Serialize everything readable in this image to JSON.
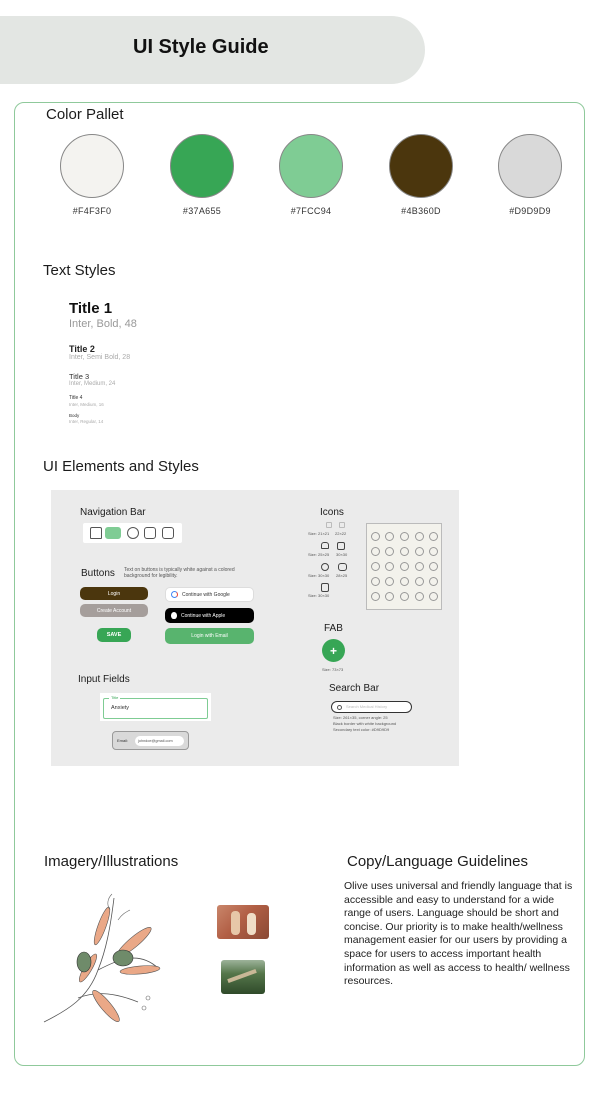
{
  "header": {
    "title": "UI Style Guide"
  },
  "color_pallet": {
    "title": "Color Pallet",
    "swatches": [
      {
        "hex": "#F4F3F0",
        "label": "#F4F3F0"
      },
      {
        "hex": "#37A655",
        "label": "#37A655"
      },
      {
        "hex": "#7FCC94",
        "label": "#7FCC94"
      },
      {
        "hex": "#4B360D",
        "label": "#4B360D"
      },
      {
        "hex": "#D9D9D9",
        "label": "#D9D9D9"
      }
    ]
  },
  "text_styles": {
    "title": "Text Styles",
    "items": [
      {
        "name": "Title 1",
        "spec": "Inter, Bold, 48"
      },
      {
        "name": "Title 2",
        "spec": "Inter, Semi Bold, 28"
      },
      {
        "name": "Title 3",
        "spec": "Inter, Medium, 24"
      },
      {
        "name": "Title 4",
        "spec": "Inter, Medium, 16"
      },
      {
        "name": "Body",
        "spec": "Inter, Regular, 14"
      }
    ]
  },
  "ui_elements": {
    "title": "UI Elements and Styles",
    "navigation_bar": "Navigation Bar",
    "buttons": {
      "title": "Buttons",
      "note": "Text on buttons is typically white against a colored background for legibility.",
      "login": "Login",
      "create_account": "Create Account",
      "save": "SAVE",
      "google": "Continue with Google",
      "apple": "Continue with Apple",
      "email": "Login with Email"
    },
    "input_fields": {
      "title": "Input Fields",
      "field_label": "Title",
      "field_value": "Anxiety",
      "email_label": "Email:",
      "email_value": "johndoe@gmail.com"
    },
    "icons": {
      "title": "Icons",
      "sizes": [
        "Size: 21×21",
        "22×22",
        "Size: 25×25",
        "30×30",
        "Size: 30×30",
        "28×25",
        "Size: 30×30"
      ]
    },
    "fab": {
      "title": "FAB",
      "glyph": "+",
      "size": "Size: 73×73"
    },
    "search_bar": {
      "title": "Search Bar",
      "placeholder": "Search Medical History",
      "spec_1": "Size: 261×35, corner angle: 25",
      "spec_2": "Black border with white background",
      "spec_3": "Secondary text color: #D9D9D9"
    }
  },
  "imagery": {
    "title": "Imagery/Illustrations"
  },
  "copy": {
    "title": "Copy/Language Guidelines",
    "body": "Olive uses universal and friendly language that is accessible and easy to understand for a wide range of users. Language should be short and concise. Our priority is to make health/wellness management easier for our users by providing a space for users to access important health information as well as access to health/ wellness resources."
  }
}
